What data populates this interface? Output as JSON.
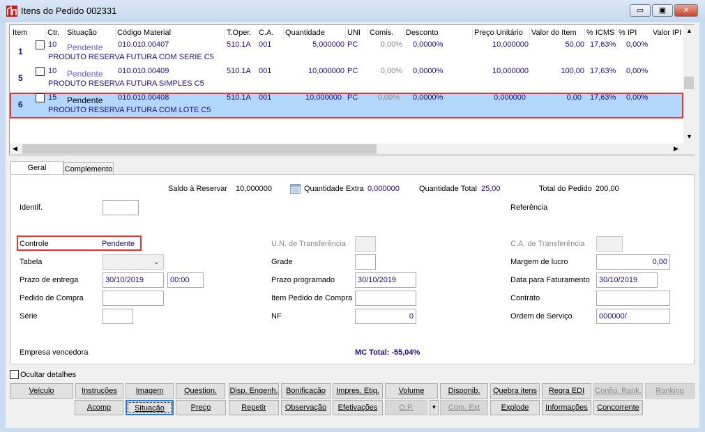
{
  "window": {
    "title": "Itens do Pedido 002331",
    "icon": "company-logo-icon",
    "controls": {
      "minimize": "▭",
      "maximize": "▣",
      "close": "✕"
    }
  },
  "grid": {
    "columns": [
      "Item",
      "Ctr.",
      "Situação",
      "Código Material",
      "T.Oper.",
      "C.A.",
      "Quantidade",
      "UNI",
      "Comis.",
      "Desconto",
      "Preço Unitário",
      "Valor do Item",
      "% ICMS",
      "% IPI",
      "Valor IPI"
    ],
    "rows": [
      {
        "item": "1",
        "ctr": "10",
        "situacao": "Pendente",
        "codigo": "010.010.00407",
        "toper": "510.1A",
        "ca": "001",
        "quantidade": "5,000000",
        "uni": "PC",
        "comis": "0,00%",
        "desconto": "0,0000%",
        "preco": "10,000000",
        "valor": "50,00",
        "icms": "17,63%",
        "ipi": "0,00%",
        "descricao": "PRODUTO RESERVA FUTURA COM SERIE C5",
        "selected": false
      },
      {
        "item": "5",
        "ctr": "10",
        "situacao": "Pendente",
        "codigo": "010.010.00409",
        "toper": "510.1A",
        "ca": "001",
        "quantidade": "10,000000",
        "uni": "PC",
        "comis": "0,00%",
        "desconto": "0,0000%",
        "preco": "10,000000",
        "valor": "100,00",
        "icms": "17,63%",
        "ipi": "0,00%",
        "descricao": "PRODUTO RESERVA FUTURA SIMPLES C5",
        "selected": false
      },
      {
        "item": "6",
        "ctr": "15",
        "situacao": "Pendente",
        "codigo": "010.010.00408",
        "toper": "510.1A",
        "ca": "001",
        "quantidade": "10,000000",
        "uni": "PC",
        "comis": "0,00%",
        "desconto": "0,0000%",
        "preco": "0,000000",
        "valor": "0,00",
        "icms": "17,63%",
        "ipi": "0,00%",
        "descricao": "PRODUTO RESERVA FUTURA  COM LOTE C5",
        "selected": true
      }
    ]
  },
  "tabs": [
    "Geral",
    "Complemento"
  ],
  "summary": {
    "saldo_label": "Saldo à Reservar",
    "saldo": "10,000000",
    "extra_label": "Quantidade Extra",
    "extra": "0,000000",
    "qtd_total_label": "Quantidade Total",
    "qtd_total": "25,00",
    "total_label": "Total do Pedido",
    "total": "200,00"
  },
  "form": {
    "identif": "Identif.",
    "referencia": "Referência",
    "controle": "Controle",
    "controle_value": "Pendente",
    "un_transf": "U.N. de Transferência",
    "ca_transf": "C.A. de Transferência",
    "tabela": "Tabela",
    "grade": "Grade",
    "margem": "Margem de lucro",
    "margem_value": "0,00",
    "prazo_entrega": "Prazo de entrega",
    "prazo_entrega_date": "30/10/2019",
    "prazo_entrega_time": "00:00",
    "prazo_prog": "Prazo programado",
    "prazo_prog_value": "30/10/2019",
    "data_fat": "Data para Faturamento",
    "data_fat_value": "30/10/2019",
    "pedido_compra": "Pedido de Compra",
    "item_pedido": "Item Pedido de Compra",
    "contrato": "Contrato",
    "serie": "Série",
    "nf": "NF",
    "nf_value": "0",
    "ordem": "Ordem de Serviço",
    "ordem_value": "000000/",
    "empresa": "Empresa vencedora",
    "mc_total": "MC Total: -55,04%"
  },
  "ocultar": "Ocultar detalhes",
  "buttons_row1": [
    "Veículo",
    "Instruções",
    "Imagem",
    "Question.",
    "Disp. Engenh.",
    "Bonificação",
    "Impres. Etiq.",
    "Volume",
    "Disponib.",
    "Quebra itens",
    "Regra EDI",
    "Config. Rank.",
    "Ranking"
  ],
  "buttons_row2": [
    "Acomp",
    "Situação",
    "Preço",
    "Repetir",
    "Observação",
    "Efetivações",
    "O.P.",
    "Com. Ext",
    "Explode",
    "Informações",
    "Concorrente"
  ],
  "colors": {
    "selection": "#b3d7fb",
    "highlight": "#e8322f",
    "value_text": "#1a0a8a"
  }
}
